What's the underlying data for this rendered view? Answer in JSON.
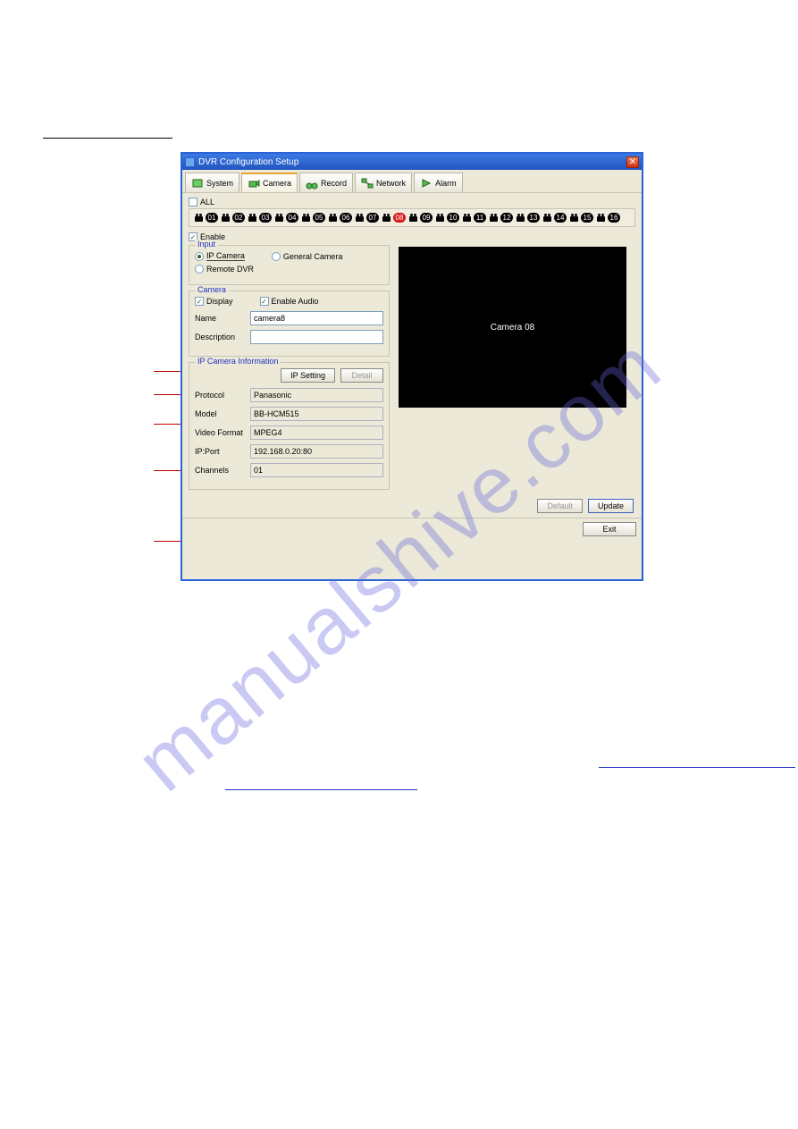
{
  "window": {
    "title": "DVR Configuration Setup"
  },
  "tabs": {
    "system": "System",
    "camera": "Camera",
    "record": "Record",
    "network": "Network",
    "alarm": "Alarm"
  },
  "all_label": "ALL",
  "cameras": [
    "01",
    "02",
    "03",
    "04",
    "05",
    "06",
    "07",
    "08",
    "09",
    "10",
    "11",
    "12",
    "13",
    "14",
    "15",
    "16"
  ],
  "selected_camera_index": 7,
  "enable_label": "Enable",
  "input": {
    "title": "Input",
    "ip_camera": "IP Camera",
    "general_camera": "General Camera",
    "remote_dvr": "Remote DVR"
  },
  "camera_group": {
    "title": "Camera",
    "display": "Display",
    "enable_audio": "Enable Audio",
    "name_label": "Name",
    "name_value": "camera8",
    "desc_label": "Description",
    "desc_value": ""
  },
  "ipinfo": {
    "title": "IP Camera Information",
    "ip_setting": "IP Setting",
    "detail": "Detail",
    "protocol_label": "Protocol",
    "protocol_value": "Panasonic",
    "model_label": "Model",
    "model_value": "BB-HCM515",
    "vformat_label": "Video Format",
    "vformat_value": "MPEG4",
    "ipport_label": "IP:Port",
    "ipport_value": "192.168.0.20:80",
    "channels_label": "Channels",
    "channels_value": "01"
  },
  "preview_text": "Camera 08",
  "buttons": {
    "default": "Default",
    "update": "Update",
    "exit": "Exit"
  },
  "watermark": "manualshive.com"
}
